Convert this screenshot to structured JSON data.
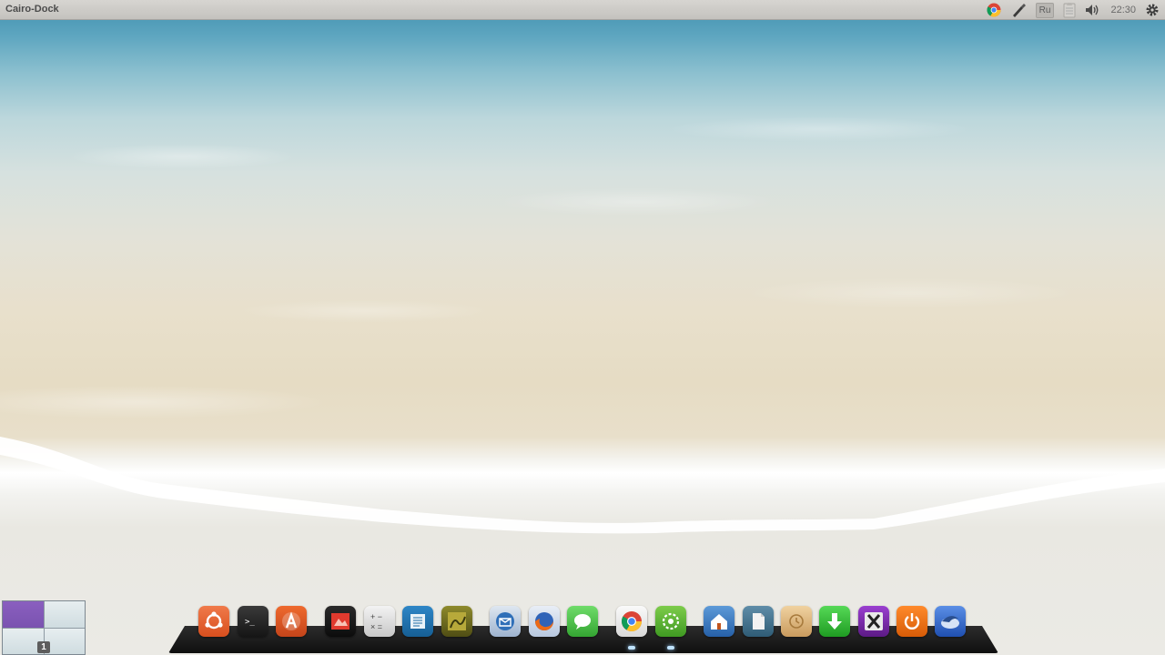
{
  "top_panel": {
    "title": "Cairo-Dock",
    "tray": {
      "language": "Ru",
      "clock": "22:30"
    }
  },
  "workspace_switcher": {
    "current_workspace": "1"
  },
  "dock": {
    "items": [
      {
        "icon": "ubuntu-icon",
        "color": "#e55b2b"
      },
      {
        "icon": "terminal-icon",
        "color": "#2b2b2b"
      },
      {
        "icon": "software-center-icon",
        "color": "#d9531e"
      },
      {
        "icon": "photo-viewer-icon",
        "color": "#1d1d1d"
      },
      {
        "icon": "calculator-icon",
        "color": "#d8d8d8"
      },
      {
        "icon": "text-editor-icon",
        "color": "#1f6fa6"
      },
      {
        "icon": "image-editor-icon",
        "color": "#6d6a1e"
      },
      {
        "icon": "email-client-icon",
        "color": "#2a6fb4"
      },
      {
        "icon": "firefox-icon",
        "color": "#e2651b"
      },
      {
        "icon": "messaging-icon",
        "color": "#4cc24a"
      },
      {
        "icon": "chrome-icon",
        "color": "#e9e9e9"
      },
      {
        "icon": "ubuntu-tweak-icon",
        "color": "#5fb534"
      },
      {
        "icon": "home-folder-icon",
        "color": "#3a79c3"
      },
      {
        "icon": "documents-icon",
        "color": "#3f6e88"
      },
      {
        "icon": "backup-icon",
        "color": "#d8b37a"
      },
      {
        "icon": "downloads-icon",
        "color": "#30b232"
      },
      {
        "icon": "xchat-icon",
        "color": "#7c2aa6"
      },
      {
        "icon": "shutdown-icon",
        "color": "#ec6d14"
      },
      {
        "icon": "thunderbird-icon",
        "color": "#2f5ec0"
      }
    ]
  }
}
